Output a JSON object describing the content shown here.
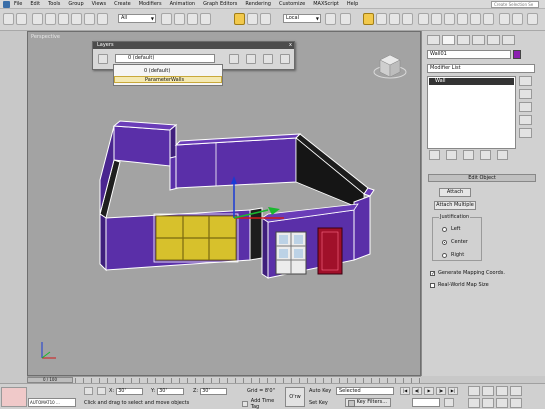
{
  "menu": {
    "items": [
      "File",
      "Edit",
      "Tools",
      "Group",
      "Views",
      "Create",
      "Modifiers",
      "Animation",
      "Graph Editors",
      "Rendering",
      "Customize",
      "MAXScript",
      "Help"
    ],
    "search_placeholder": "Create Selection Se"
  },
  "toolbar": {
    "selection_filter": "All",
    "reference_coord": "Local"
  },
  "viewport": {
    "label": "Perspective"
  },
  "layers_dialog": {
    "title": "Layers",
    "close_glyph": "x",
    "current_layer": "0 (default)",
    "dropdown_rows": [
      "0 (default)",
      "ParameterWalls"
    ]
  },
  "command_panel": {
    "object_name": "Wall01",
    "object_color": "#8b1fb0",
    "modifier_list": "Modifier List",
    "stack_item": "Wall",
    "rollout_title": "Edit Object",
    "attach_label": "Attach",
    "attach_multiple_label": "Attach Multiple",
    "justification_label": "Justification",
    "justification_options": [
      "Left",
      "Center",
      "Right"
    ],
    "justification_selected": "Center",
    "generate_mapping": "Generate Mapping Coords.",
    "generate_mapping_checked": true,
    "real_world_map": "Real-World Map Size",
    "real_world_checked": false
  },
  "timebar": {
    "slider_label": "0 / 100"
  },
  "status": {
    "script_text": "AUTOMAT10 ...",
    "prompt": "Click and drag to select and move objects",
    "x_label": "X:",
    "x_value": "30'",
    "y_label": "Y:",
    "y_value": "30'",
    "z_label": "Z:",
    "z_value": "30'",
    "grid": "Grid = 8'0\"",
    "add_time_tag": "Add Time Tag",
    "big_key_label": "O'rw",
    "auto_key": "Auto Key",
    "set_key": "Set Key",
    "selected": "Selected",
    "key_filters": "Key Filters..."
  },
  "colors": {
    "wall_purple": "#5a2fa8",
    "wall_dark": "#1d1d1d",
    "window_yellow": "#d7c12c",
    "door_red": "#a0102a",
    "selection_white": "#ffffff"
  },
  "icons": {
    "toolbar": [
      "undo-icon",
      "redo-icon",
      "link-icon",
      "unlink-icon",
      "bind-icon",
      "select-icon",
      "select-by-name-icon",
      "rect-select-icon",
      "window-crossing-icon",
      "move-icon",
      "rotate-icon",
      "scale-icon",
      "pivot-icon",
      "snap-icon",
      "angle-snap-icon",
      "percent-snap-icon",
      "mirror-icon",
      "align-icon",
      "layer-manager-icon",
      "curve-editor-icon",
      "schematic-icon",
      "material-editor-icon",
      "render-setup-icon",
      "render-icon"
    ]
  }
}
